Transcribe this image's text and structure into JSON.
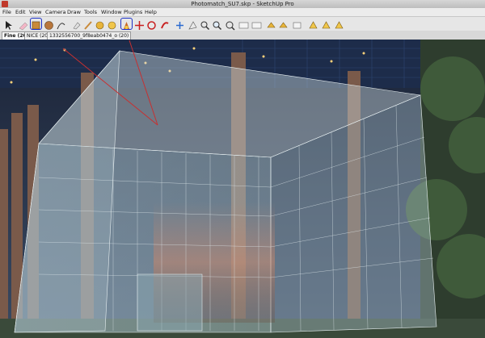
{
  "window": {
    "title": "Photomatch_SU7.skp - SketchUp Pro"
  },
  "menu": [
    {
      "label": "File"
    },
    {
      "label": "Edit"
    },
    {
      "label": "View"
    },
    {
      "label": "Camera"
    },
    {
      "label": "Draw"
    },
    {
      "label": "Tools"
    },
    {
      "label": "Window"
    },
    {
      "label": "Plugins"
    },
    {
      "label": "Help"
    }
  ],
  "scene_tabs": [
    {
      "label": "Fine (20)"
    },
    {
      "label": "NICE (20)"
    },
    {
      "label": "1332556700_9f8eab0474_o (20)"
    }
  ],
  "toolbar": {
    "tools": [
      "select-icon",
      "rectangle-icon",
      "circle-icon",
      "arc-icon",
      "eraser-icon",
      "paint-icon",
      "push-pull-icon",
      "move-icon",
      "rotate-icon",
      "offset-icon",
      "orbit-icon",
      "pan-icon",
      "zoom-icon",
      "zoom-window-icon",
      "zoom-extents-icon",
      "previous-icon",
      "next-icon",
      "tape-icon",
      "dimension-icon",
      "protractor-icon",
      "text-icon",
      "axes-icon",
      "3d-text-icon",
      "section-icon",
      "walk-icon",
      "look-around-icon",
      "position-camera-icon"
    ]
  },
  "colors": {
    "accent": "#1a2fc8",
    "menu_bg": "#ececec"
  }
}
